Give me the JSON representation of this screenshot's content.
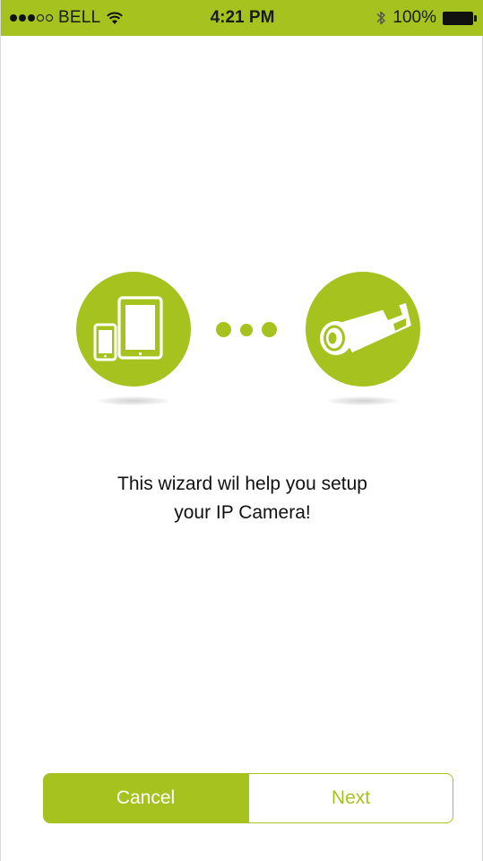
{
  "status_bar": {
    "carrier": "BELL",
    "time": "4:21 PM",
    "battery": "100%",
    "signal_bars_filled": 3,
    "signal_bars_total": 5,
    "wifi_icon": "wifi-icon",
    "bluetooth_icon": "bluetooth-icon",
    "battery_icon": "battery-full-icon",
    "color": "#a5c21f"
  },
  "illustration": {
    "left_icon": "phone-tablet-icon",
    "right_icon": "ip-camera-icon",
    "connector": "dots-icon",
    "accent": "#a5c21f"
  },
  "message": {
    "line1": "This wizard wil help you setup",
    "line2": "your IP Camera!"
  },
  "buttons": {
    "cancel_label": "Cancel",
    "next_label": "Next"
  }
}
